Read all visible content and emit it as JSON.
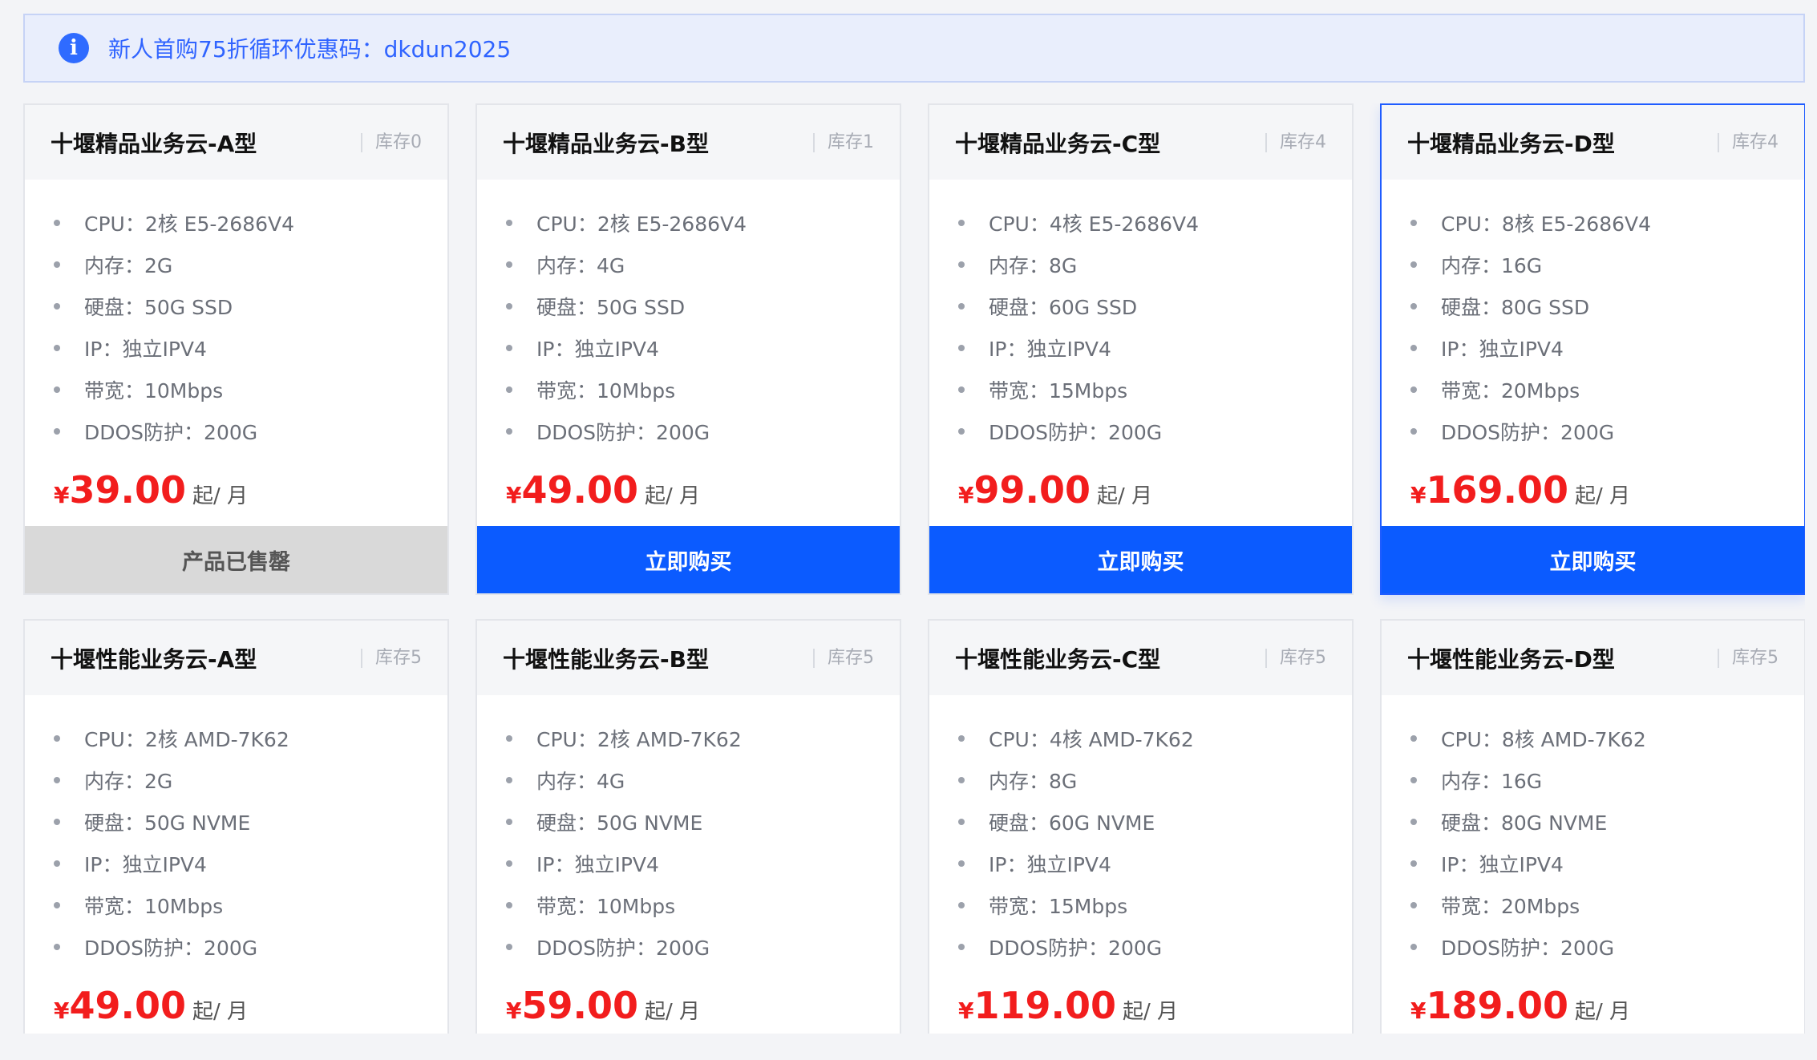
{
  "notice": {
    "icon": "info-icon",
    "text": "新人首购75折循环优惠码：dkdun2025"
  },
  "colors": {
    "accent": "#0b5bff",
    "price": "#f21d1d",
    "sold_out": "#d9d9d9"
  },
  "cards": [
    {
      "title": "十堰精品业务云-A型",
      "stock": "库存0",
      "highlight": false,
      "specs": [
        "CPU：2核 E5-2686V4",
        "内存：2G",
        "硬盘：50G SSD",
        "IP：独立IPV4",
        "带宽：10Mbps",
        "DDOS防护：200G"
      ],
      "currency": "¥",
      "price": "39.00",
      "unit": "起/ 月",
      "button": "产品已售罄",
      "button_type": "sold"
    },
    {
      "title": "十堰精品业务云-B型",
      "stock": "库存1",
      "highlight": false,
      "specs": [
        "CPU：2核 E5-2686V4",
        "内存：4G",
        "硬盘：50G SSD",
        "IP：独立IPV4",
        "带宽：10Mbps",
        "DDOS防护：200G"
      ],
      "currency": "¥",
      "price": "49.00",
      "unit": "起/ 月",
      "button": "立即购买",
      "button_type": "buy"
    },
    {
      "title": "十堰精品业务云-C型",
      "stock": "库存4",
      "highlight": false,
      "specs": [
        "CPU：4核 E5-2686V4",
        "内存：8G",
        "硬盘：60G SSD",
        "IP：独立IPV4",
        "带宽：15Mbps",
        "DDOS防护：200G"
      ],
      "currency": "¥",
      "price": "99.00",
      "unit": "起/ 月",
      "button": "立即购买",
      "button_type": "buy"
    },
    {
      "title": "十堰精品业务云-D型",
      "stock": "库存4",
      "highlight": true,
      "specs": [
        "CPU：8核 E5-2686V4",
        "内存：16G",
        "硬盘：80G SSD",
        "IP：独立IPV4",
        "带宽：20Mbps",
        "DDOS防护：200G"
      ],
      "currency": "¥",
      "price": "169.00",
      "unit": "起/ 月",
      "button": "立即购买",
      "button_type": "buy"
    },
    {
      "title": "十堰性能业务云-A型",
      "stock": "库存5",
      "highlight": false,
      "specs": [
        "CPU：2核 AMD-7K62",
        "内存：2G",
        "硬盘：50G NVME",
        "IP：独立IPV4",
        "带宽：10Mbps",
        "DDOS防护：200G"
      ],
      "currency": "¥",
      "price": "49.00",
      "unit": "起/ 月",
      "button": "",
      "button_type": "none"
    },
    {
      "title": "十堰性能业务云-B型",
      "stock": "库存5",
      "highlight": false,
      "specs": [
        "CPU：2核 AMD-7K62",
        "内存：4G",
        "硬盘：50G NVME",
        "IP：独立IPV4",
        "带宽：10Mbps",
        "DDOS防护：200G"
      ],
      "currency": "¥",
      "price": "59.00",
      "unit": "起/ 月",
      "button": "",
      "button_type": "none"
    },
    {
      "title": "十堰性能业务云-C型",
      "stock": "库存5",
      "highlight": false,
      "specs": [
        "CPU：4核 AMD-7K62",
        "内存：8G",
        "硬盘：60G NVME",
        "IP：独立IPV4",
        "带宽：15Mbps",
        "DDOS防护：200G"
      ],
      "currency": "¥",
      "price": "119.00",
      "unit": "起/ 月",
      "button": "",
      "button_type": "none"
    },
    {
      "title": "十堰性能业务云-D型",
      "stock": "库存5",
      "highlight": false,
      "specs": [
        "CPU：8核 AMD-7K62",
        "内存：16G",
        "硬盘：80G NVME",
        "IP：独立IPV4",
        "带宽：20Mbps",
        "DDOS防护：200G"
      ],
      "currency": "¥",
      "price": "189.00",
      "unit": "起/ 月",
      "button": "",
      "button_type": "none"
    }
  ]
}
